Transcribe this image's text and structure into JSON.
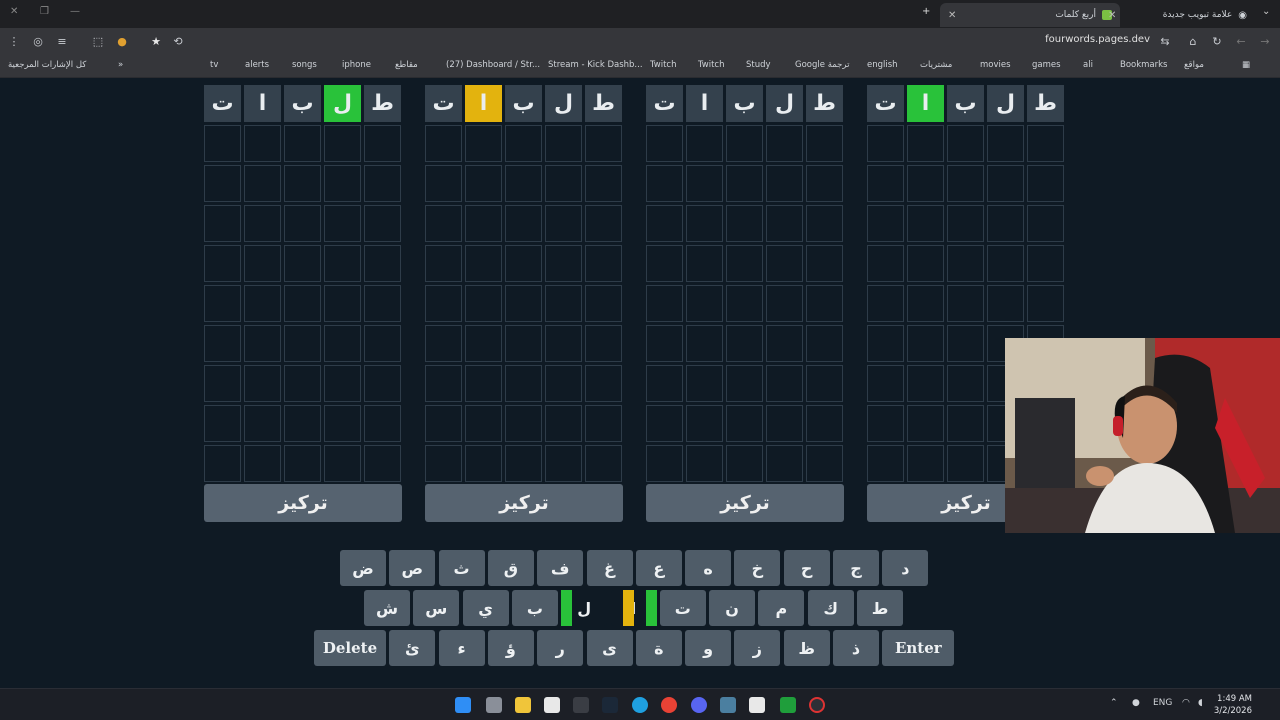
{
  "browser": {
    "tabs": [
      {
        "label": "علامة تبويب جديدة"
      },
      {
        "label": "أربع كلمات"
      }
    ],
    "url": "fourwords.pages.dev",
    "bookmarks": [
      "Bookmarks",
      "ali",
      "games",
      "movies",
      "مشتريات",
      "english",
      "Google ترجمة",
      "Study",
      "Twitch",
      "Twitch",
      "Stream - Kick Dashb...",
      "(27) Dashboard / Str...",
      "مقاطع",
      "iphone",
      "songs",
      "alerts",
      "tv",
      "كل الإشارات المرجعية",
      "مواقع"
    ]
  },
  "boards": [
    {
      "focus_label": "تركيز",
      "guess": [
        {
          "letter": "ت",
          "state": "none"
        },
        {
          "letter": "ا",
          "state": "none"
        },
        {
          "letter": "ب",
          "state": "none"
        },
        {
          "letter": "ل",
          "state": "green"
        },
        {
          "letter": "ط",
          "state": "none"
        }
      ]
    },
    {
      "focus_label": "تركيز",
      "guess": [
        {
          "letter": "ت",
          "state": "none"
        },
        {
          "letter": "ا",
          "state": "yellow"
        },
        {
          "letter": "ب",
          "state": "none"
        },
        {
          "letter": "ل",
          "state": "none"
        },
        {
          "letter": "ط",
          "state": "none"
        }
      ]
    },
    {
      "focus_label": "تركيز",
      "guess": [
        {
          "letter": "ت",
          "state": "none"
        },
        {
          "letter": "ا",
          "state": "none"
        },
        {
          "letter": "ب",
          "state": "none"
        },
        {
          "letter": "ل",
          "state": "none"
        },
        {
          "letter": "ط",
          "state": "none"
        }
      ]
    },
    {
      "focus_label": "تركيز",
      "guess": [
        {
          "letter": "ت",
          "state": "none"
        },
        {
          "letter": "ا",
          "state": "green"
        },
        {
          "letter": "ب",
          "state": "none"
        },
        {
          "letter": "ل",
          "state": "none"
        },
        {
          "letter": "ط",
          "state": "none"
        }
      ]
    }
  ],
  "keyboard": {
    "row1": [
      "ض",
      "ص",
      "ث",
      "ق",
      "ف",
      "غ",
      "ع",
      "ه",
      "خ",
      "ح",
      "ج",
      "د"
    ],
    "row2": [
      "ش",
      "س",
      "ي",
      "ب",
      "ل",
      "ا",
      "ت",
      "ن",
      "م",
      "ك",
      "ط"
    ],
    "row3": [
      "Delete",
      "ئ",
      "ء",
      "ؤ",
      "ر",
      "ى",
      "ة",
      "و",
      "ز",
      "ظ",
      "ذ",
      "Enter"
    ]
  },
  "taskbar": {
    "language": "ENG",
    "time": "1:49 AM",
    "date": "3/2/2026"
  },
  "colors": {
    "green": "#29c23a",
    "yellow": "#e3b30e",
    "tile": "#34414d",
    "key": "#4f5c68"
  }
}
